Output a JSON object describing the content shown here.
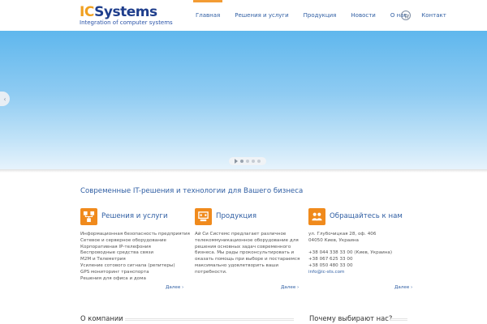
{
  "logo": {
    "main_prefix": "IC",
    "main_suffix": "Systems",
    "subtitle": "Integration of computer systems"
  },
  "nav": {
    "items": [
      {
        "label": "Главная",
        "active": true
      },
      {
        "label": "Решения и услуги"
      },
      {
        "label": "Продукция"
      },
      {
        "label": "Новости"
      },
      {
        "label": "О нас"
      },
      {
        "label": "Контакт"
      }
    ],
    "cart_icon": "cart-icon"
  },
  "slider": {
    "prev_arrow": "‹"
  },
  "tagline": "Современные IT-решения и технологии для Вашего бизнеса",
  "columns": [
    {
      "title": "Решения и услуги",
      "icon": "services-icon",
      "lines": [
        "Информационная безопасность предприятия",
        "Сетевое и серверное оборудование",
        "Корпоративная IP-телефония",
        "Беспроводные средства связи",
        "M2M и Телеметрия",
        "Усиление сотового сигнала (репитеры)",
        "GPS мониторинг транспорта",
        "Решения для офиса и дома"
      ],
      "more": "Далее ›"
    },
    {
      "title": "Продукция",
      "icon": "products-icon",
      "lines": [
        "Ай Си Системс предлагает различное",
        "телекоммуникационное оборудование для",
        "решения основных задач современного",
        "бизнеса. Мы рады проконсультировать и",
        "оказать помощь при выборе и постараемся",
        "максимально удовлетворить ваши",
        "потребности."
      ],
      "more": "Далее ›"
    },
    {
      "title": "Обращайтесь к нам",
      "icon": "contact-icon",
      "address": [
        "ул. Глубочицкая 28, оф. 406",
        "04050 Киев, Украина"
      ],
      "phones": [
        "+38 044 338 33 00 (Киев, Украина)",
        "+38 067 625 33 00",
        "+38 050 480 33 00"
      ],
      "email": "info@ic-sts.com",
      "more": "Далее ›"
    }
  ],
  "bottom": {
    "about": "О компании",
    "why": "Почему выбирают нас?"
  },
  "colors": {
    "accent": "#f08a1c",
    "link": "#2f5ea3",
    "brand": "#1f3e8c",
    "sky_top": "#5fb7ed"
  }
}
